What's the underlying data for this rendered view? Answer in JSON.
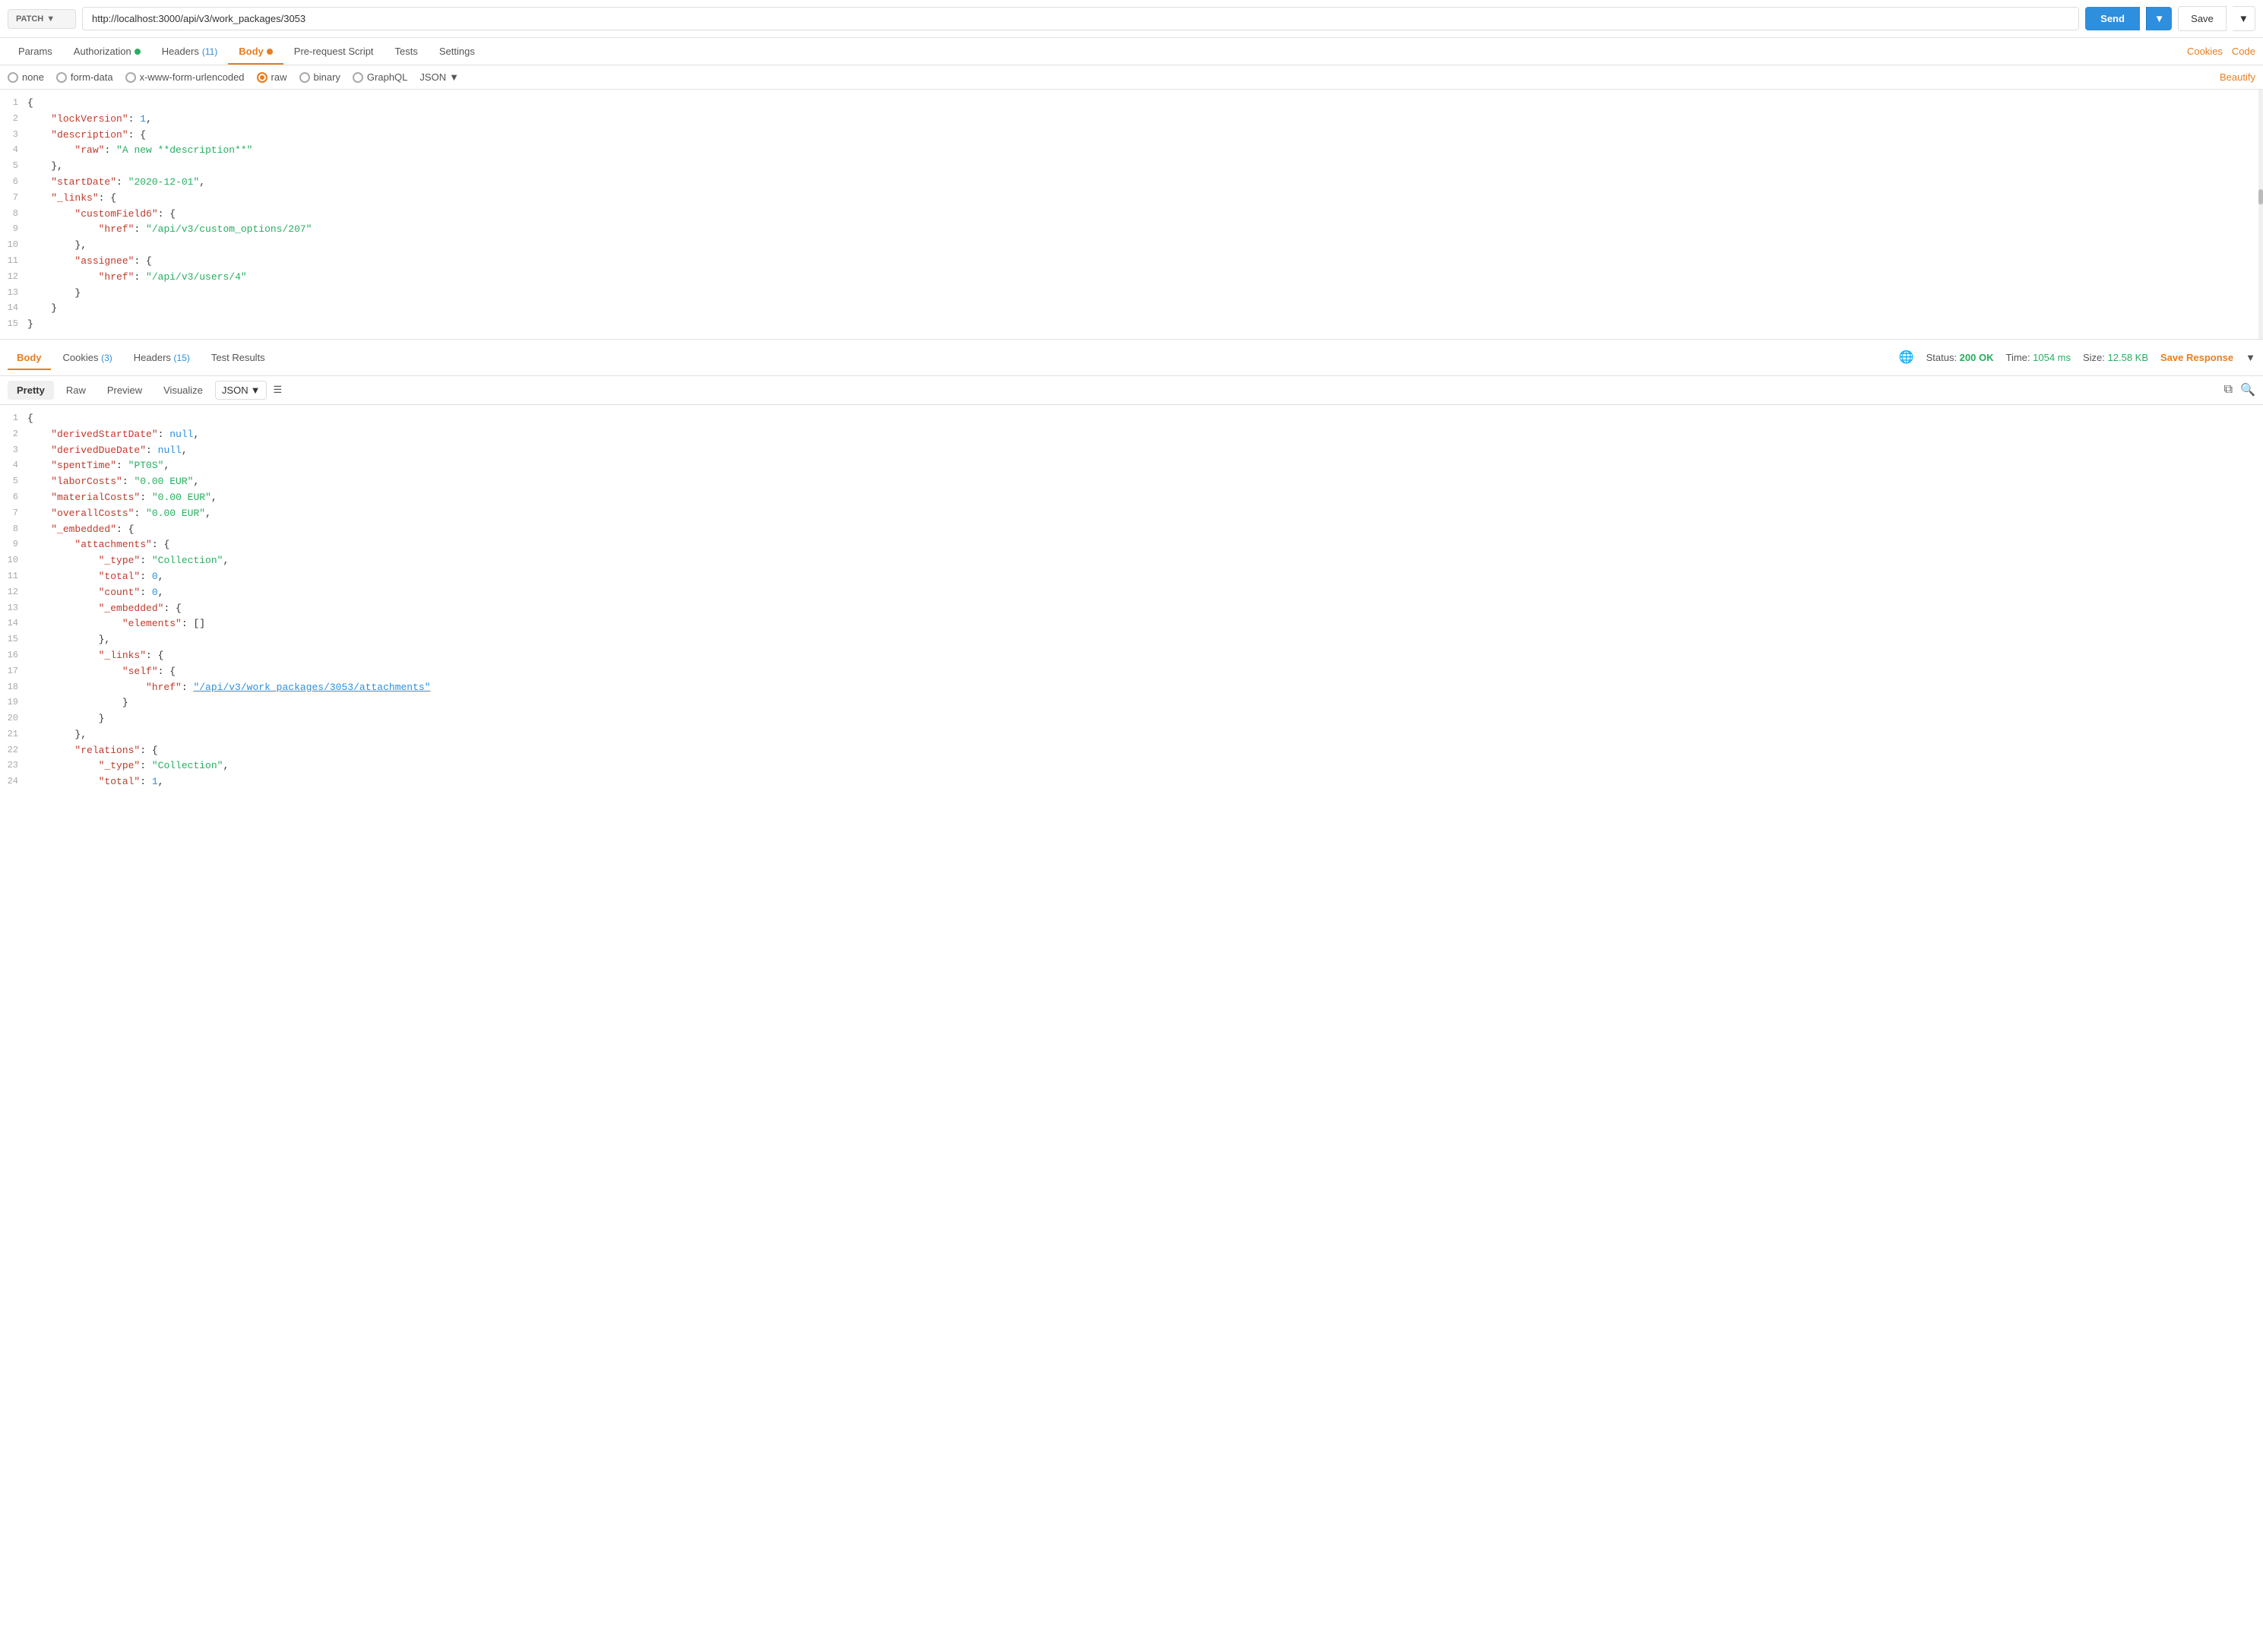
{
  "topbar": {
    "method": "PATCH",
    "url": "http://localhost:3000/api/v3/work_packages/3053",
    "send_label": "Send",
    "save_label": "Save"
  },
  "request_tabs": [
    {
      "id": "params",
      "label": "Params",
      "badge": null,
      "dot": null
    },
    {
      "id": "authorization",
      "label": "Authorization",
      "badge": null,
      "dot": "green"
    },
    {
      "id": "headers",
      "label": "Headers",
      "badge": "11",
      "dot": null
    },
    {
      "id": "body",
      "label": "Body",
      "badge": null,
      "dot": "orange"
    },
    {
      "id": "prerequest",
      "label": "Pre-request Script",
      "badge": null,
      "dot": null
    },
    {
      "id": "tests",
      "label": "Tests",
      "badge": null,
      "dot": null
    },
    {
      "id": "settings",
      "label": "Settings",
      "badge": null,
      "dot": null
    }
  ],
  "right_links": [
    "Cookies",
    "Code"
  ],
  "body_options": [
    "none",
    "form-data",
    "x-www-form-urlencoded",
    "raw",
    "binary",
    "GraphQL"
  ],
  "selected_body": "raw",
  "format": "JSON",
  "beautify_label": "Beautify",
  "request_body_lines": [
    {
      "num": 1,
      "content": "{"
    },
    {
      "num": 2,
      "content": "    \"lockVersion\": 1,"
    },
    {
      "num": 3,
      "content": "    \"description\": {"
    },
    {
      "num": 4,
      "content": "        \"raw\": \"A new **description**\""
    },
    {
      "num": 5,
      "content": "    },"
    },
    {
      "num": 6,
      "content": "    \"startDate\": \"2020-12-01\","
    },
    {
      "num": 7,
      "content": "    \"_links\": {"
    },
    {
      "num": 8,
      "content": "        \"customField6\": {"
    },
    {
      "num": 9,
      "content": "            \"href\": \"/api/v3/custom_options/207\""
    },
    {
      "num": 10,
      "content": "        },"
    },
    {
      "num": 11,
      "content": "        \"assignee\": {"
    },
    {
      "num": 12,
      "content": "            \"href\": \"/api/v3/users/4\""
    },
    {
      "num": 13,
      "content": "        }"
    },
    {
      "num": 14,
      "content": "    }"
    },
    {
      "num": 15,
      "content": "}"
    }
  ],
  "response_tabs": [
    {
      "id": "body",
      "label": "Body",
      "active": true
    },
    {
      "id": "cookies",
      "label": "Cookies",
      "badge": "3"
    },
    {
      "id": "headers",
      "label": "Headers",
      "badge": "15"
    },
    {
      "id": "test-results",
      "label": "Test Results"
    }
  ],
  "status": {
    "code": "200 OK",
    "time": "1054 ms",
    "size": "12.58 KB"
  },
  "save_response_label": "Save Response",
  "view_tabs": [
    "Pretty",
    "Raw",
    "Preview",
    "Visualize"
  ],
  "active_view": "Pretty",
  "response_format": "JSON",
  "response_body_lines": [
    {
      "num": 1,
      "content": "{"
    },
    {
      "num": 2,
      "content": "    \"derivedStartDate\": null,"
    },
    {
      "num": 3,
      "content": "    \"derivedDueDate\": null,"
    },
    {
      "num": 4,
      "content": "    \"spentTime\": \"PT0S\","
    },
    {
      "num": 5,
      "content": "    \"laborCosts\": \"0.00 EUR\","
    },
    {
      "num": 6,
      "content": "    \"materialCosts\": \"0.00 EUR\","
    },
    {
      "num": 7,
      "content": "    \"overallCosts\": \"0.00 EUR\","
    },
    {
      "num": 8,
      "content": "    \"_embedded\": {"
    },
    {
      "num": 9,
      "content": "        \"attachments\": {"
    },
    {
      "num": 10,
      "content": "            \"_type\": \"Collection\","
    },
    {
      "num": 11,
      "content": "            \"total\": 0,"
    },
    {
      "num": 12,
      "content": "            \"count\": 0,"
    },
    {
      "num": 13,
      "content": "            \"_embedded\": {"
    },
    {
      "num": 14,
      "content": "                \"elements\": []"
    },
    {
      "num": 15,
      "content": "            },"
    },
    {
      "num": 16,
      "content": "            \"_links\": {"
    },
    {
      "num": 17,
      "content": "                \"self\": {"
    },
    {
      "num": 18,
      "content": "                    \"href\": \"/api/v3/work_packages/3053/attachments\""
    },
    {
      "num": 19,
      "content": "                }"
    },
    {
      "num": 20,
      "content": "            }"
    },
    {
      "num": 21,
      "content": "        },"
    },
    {
      "num": 22,
      "content": "        \"relations\": {"
    },
    {
      "num": 23,
      "content": "            \"_type\": \"Collection\","
    },
    {
      "num": 24,
      "content": "            \"total\": 1,"
    }
  ]
}
